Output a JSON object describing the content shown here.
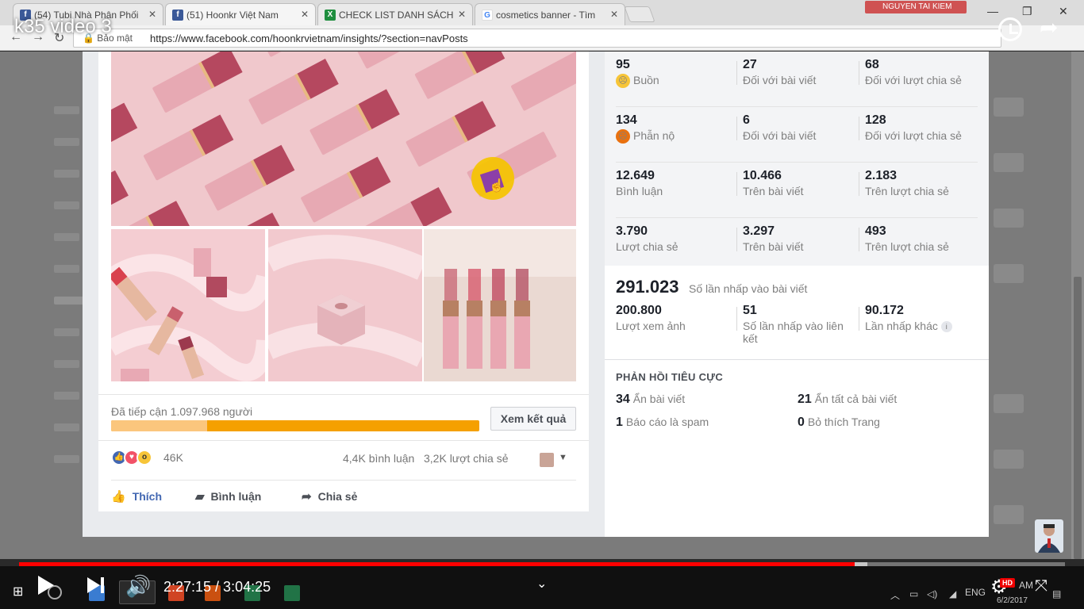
{
  "browser": {
    "tabs": [
      {
        "title": "(54) Tubi Nhà Phân Phối",
        "icon": "facebook-icon",
        "active": false
      },
      {
        "title": "(51) Hoonkr Việt Nam",
        "icon": "facebook-icon",
        "active": true
      },
      {
        "title": "CHECK LIST DANH SÁCH",
        "icon": "sheets-icon",
        "active": false
      },
      {
        "title": "cosmetics banner - Tìm",
        "icon": "google-icon",
        "active": false
      }
    ],
    "profile_name": "NGUYEN TAI KIEM",
    "security_label": "Bảo mật",
    "url": "https://www.facebook.com/hoonkrvietnam/insights/?section=navPosts"
  },
  "post": {
    "reach_label": "Đã tiếp cận 1.097.968 người",
    "reach_progress": 0.26,
    "results_button": "Xem kết quả",
    "reactions_count": "46K",
    "comments_count": "4,4K bình luận",
    "shares_count": "3,2K lượt chia sẻ",
    "actions": {
      "like": "Thích",
      "comment": "Bình luận",
      "share": "Chia sẻ"
    }
  },
  "stats": {
    "rows": [
      {
        "total": "95",
        "total_label": "Buồn",
        "emoji": "sad",
        "on_post": "27",
        "on_post_label": "Đối với bài viết",
        "on_shares": "68",
        "on_shares_label": "Đối với lượt chia sẻ"
      },
      {
        "total": "134",
        "total_label": "Phẫn nộ",
        "emoji": "angry",
        "on_post": "6",
        "on_post_label": "Đối với bài viết",
        "on_shares": "128",
        "on_shares_label": "Đối với lượt chia sẻ"
      },
      {
        "total": "12.649",
        "total_label": "Bình luận",
        "emoji": "",
        "on_post": "10.466",
        "on_post_label": "Trên bài viết",
        "on_shares": "2.183",
        "on_shares_label": "Trên lượt chia sẻ"
      },
      {
        "total": "3.790",
        "total_label": "Lượt chia sẻ",
        "emoji": "",
        "on_post": "3.297",
        "on_post_label": "Trên bài viết",
        "on_shares": "493",
        "on_shares_label": "Trên lượt chia sẻ"
      }
    ],
    "clicks_total": "291.023",
    "clicks_label": "Số lần nhấp vào bài viết",
    "clicks": [
      {
        "value": "200.800",
        "label": "Lượt xem ảnh"
      },
      {
        "value": "51",
        "label": "Số lần nhấp vào liên kết"
      },
      {
        "value": "90.172",
        "label": "Lần nhấp khác"
      }
    ],
    "negative_title": "PHẢN HỒI TIÊU CỰC",
    "negative": [
      {
        "value": "34",
        "label": "Ẩn bài viết"
      },
      {
        "value": "21",
        "label": "Ẩn tất cả bài viết"
      },
      {
        "value": "1",
        "label": "Báo cáo là spam"
      },
      {
        "value": "0",
        "label": "Bỏ thích Trang"
      }
    ]
  },
  "video": {
    "title": "k35 video 3",
    "time": "2:27:15 / 3:04:25",
    "played_fraction": 0.799,
    "buffered_fraction": 0.811,
    "quality_badge": "HD"
  },
  "system": {
    "lang": "ENG",
    "clock_ampm": "AM",
    "date": "6/2/2017"
  },
  "colors": {
    "facebook_blue": "#4267b2",
    "progress_orange": "#f5a000",
    "youtube_red": "#ff0000"
  }
}
